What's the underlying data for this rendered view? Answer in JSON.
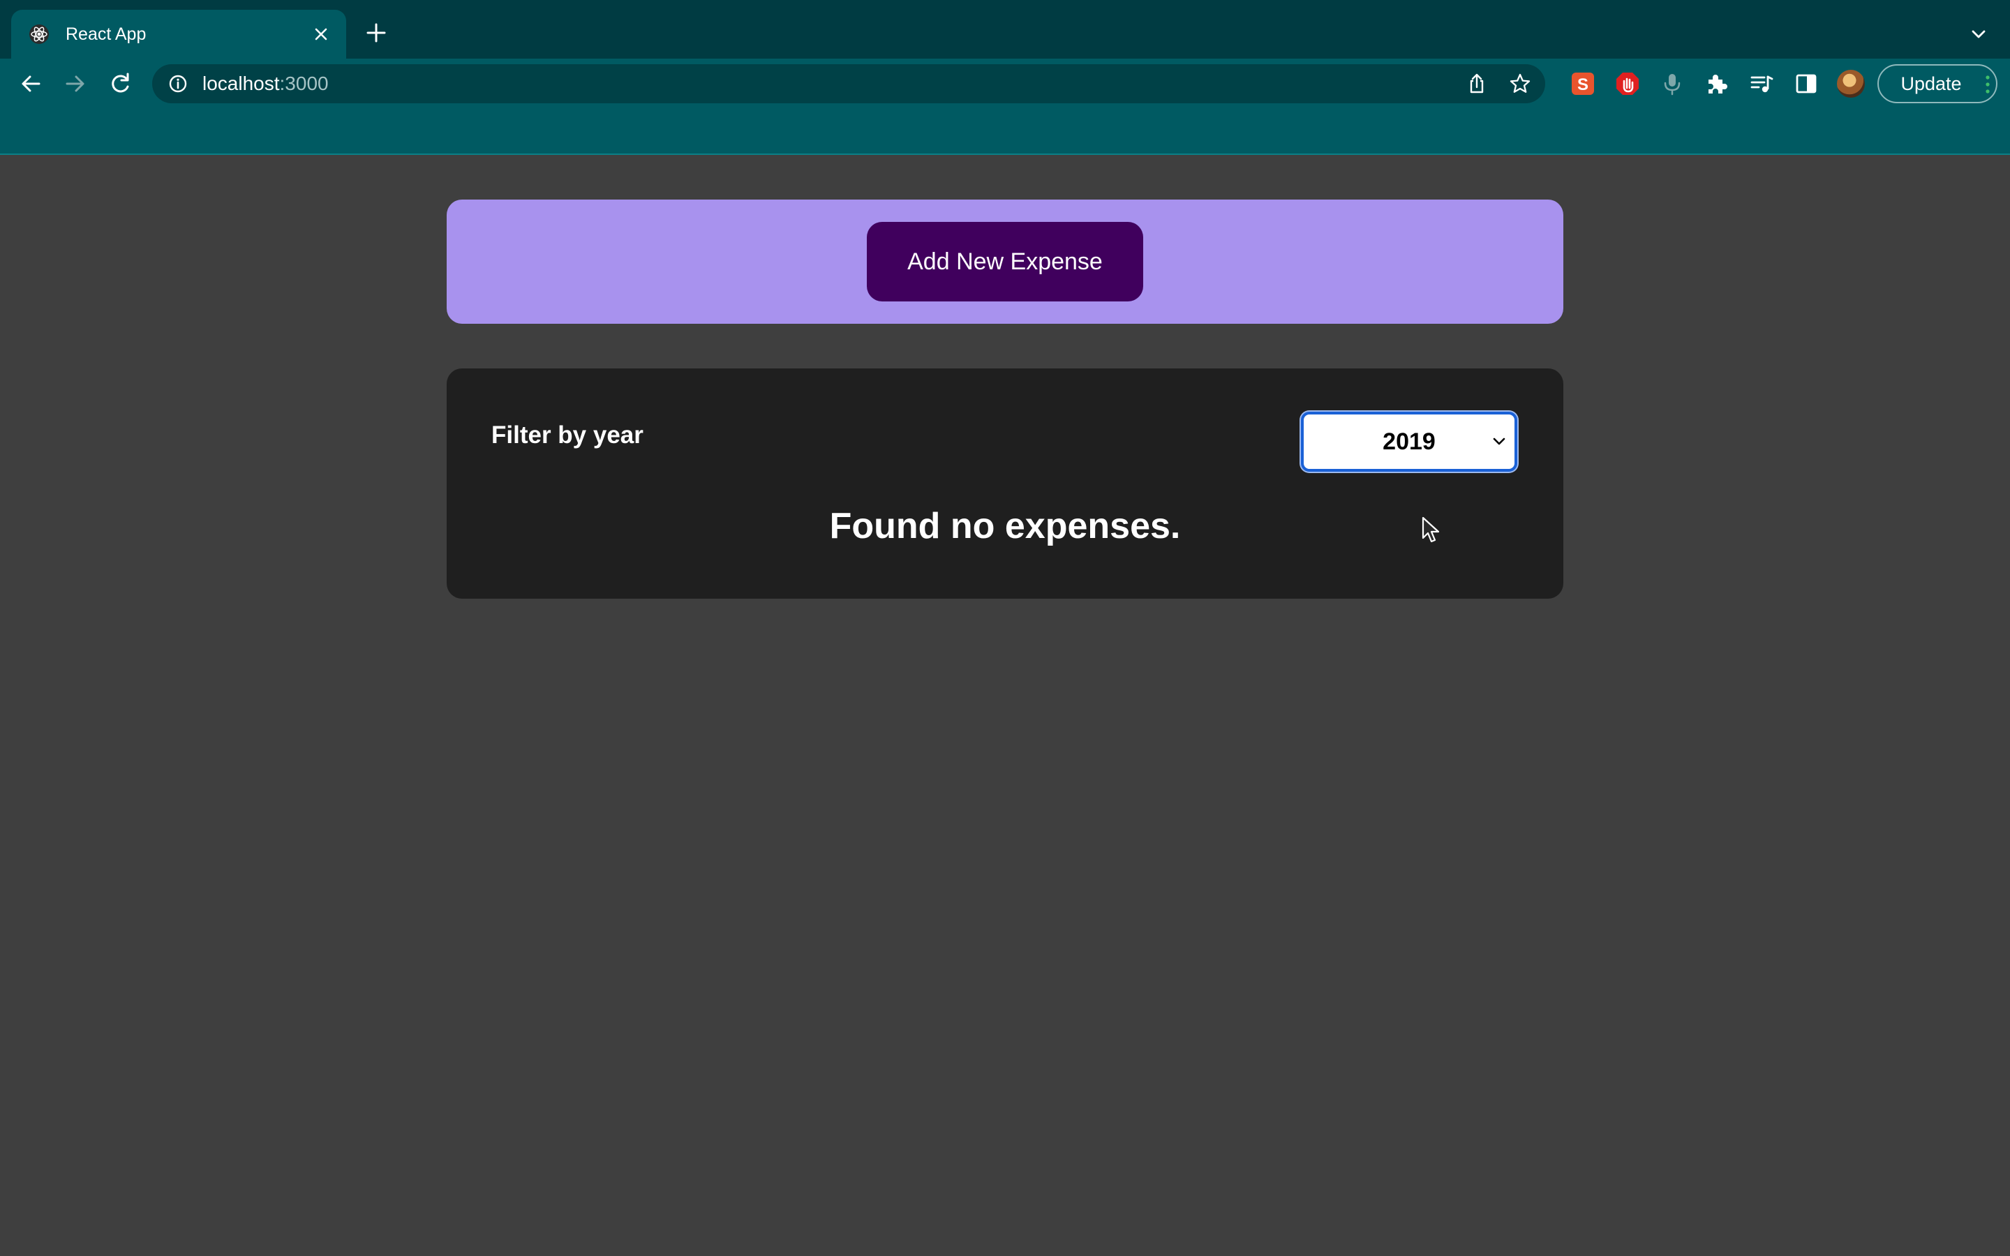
{
  "browser": {
    "tab": {
      "title": "React App",
      "favicon": "react-logo-icon"
    },
    "address_bar": {
      "host": "localhost",
      "port": ":3000"
    },
    "update_label": "Update",
    "extensions": [
      "s-extension-icon",
      "stop-hand-extension-icon",
      "microphone-icon",
      "puzzle-extensions-icon",
      "media-queue-icon",
      "side-panel-icon"
    ]
  },
  "new_expense": {
    "add_button_label": "Add New Expense",
    "colors": {
      "panel": "#a892ee",
      "button": "#40005d"
    }
  },
  "expenses": {
    "filter": {
      "label": "Filter by year",
      "selected_year": "2019"
    },
    "empty_message": "Found no expenses."
  }
}
